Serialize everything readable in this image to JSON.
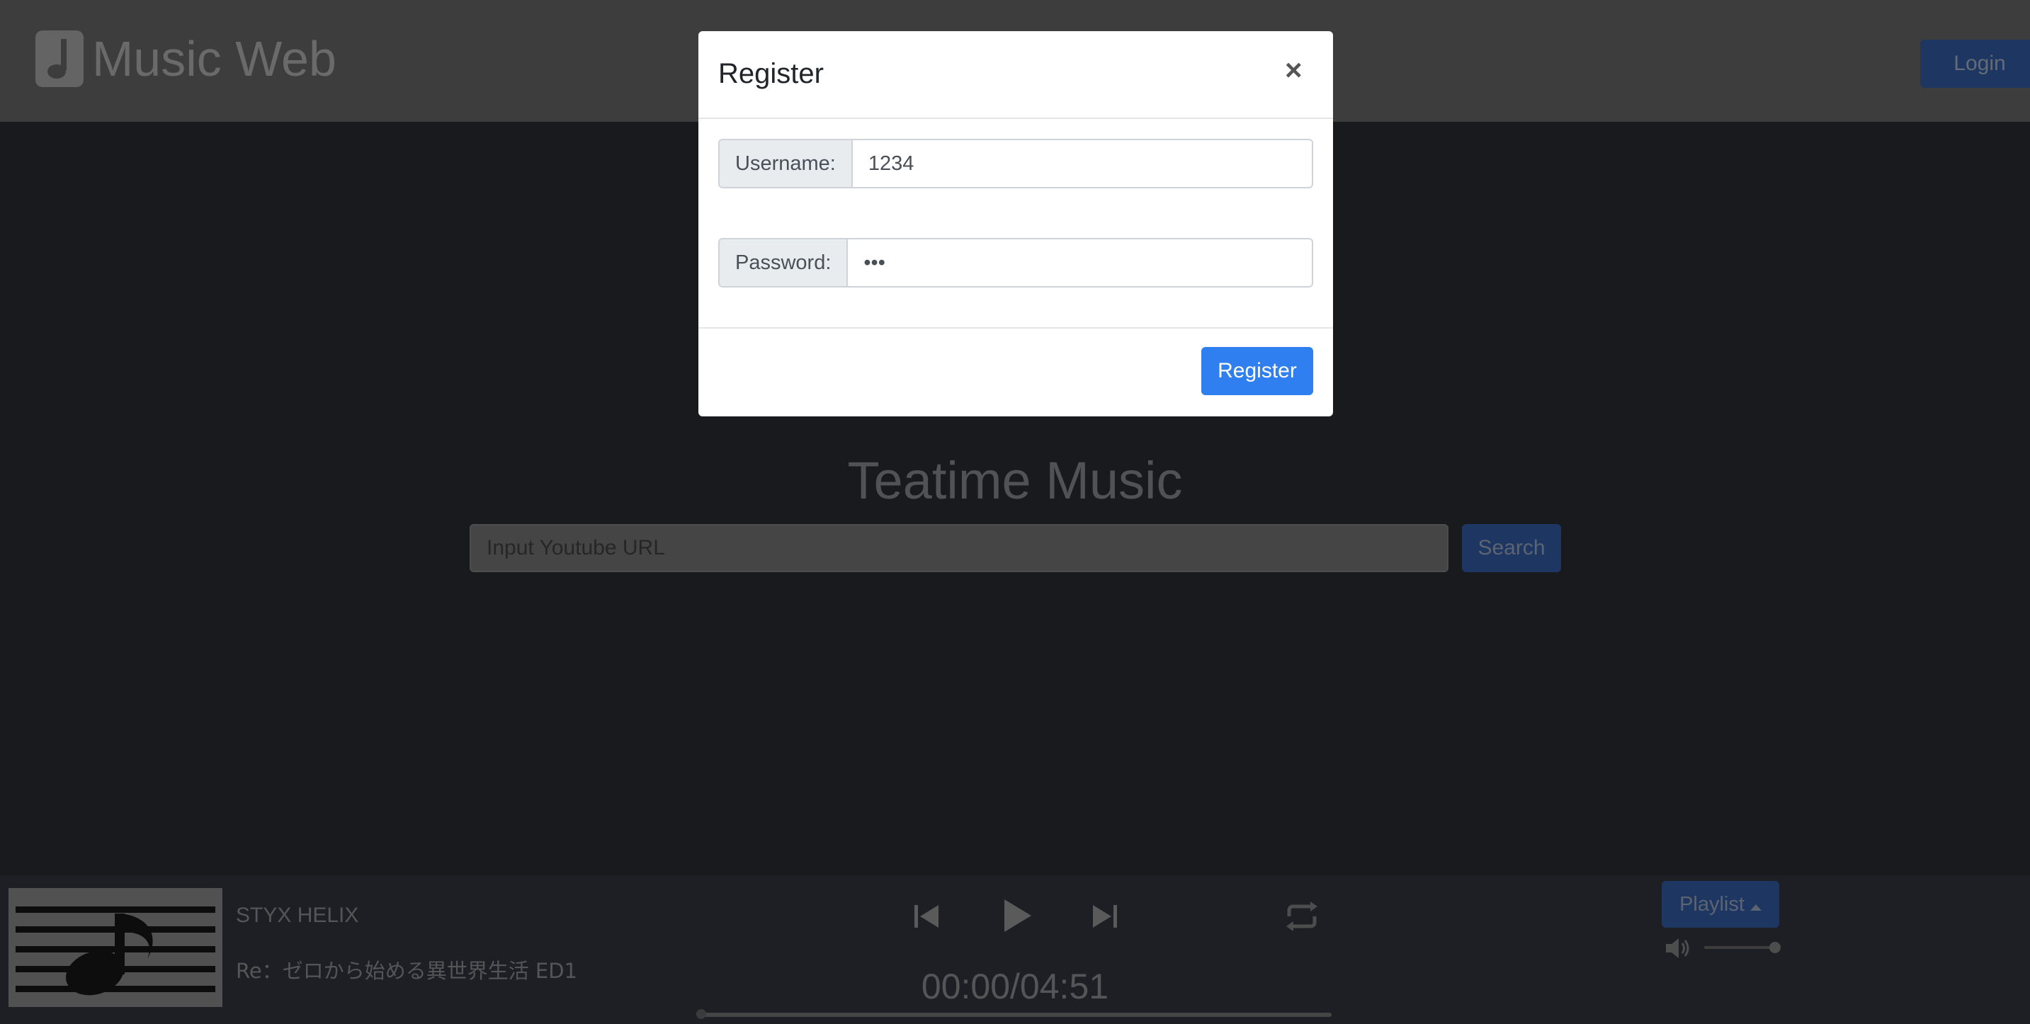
{
  "navbar": {
    "brand": "Music Web",
    "login_label": "Login"
  },
  "main": {
    "title": "Teatime Music",
    "search_placeholder": "Input Youtube URL",
    "search_label": "Search"
  },
  "player": {
    "track_title": "STYX HELIX",
    "track_subtitle": "Re：ゼロから始める異世界生活 ED1",
    "time": "00:00/04:51",
    "progress": 0.0,
    "volume": 1.0,
    "playlist_label": "Playlist"
  },
  "modal": {
    "title": "Register",
    "close_glyph": "×",
    "username_label": "Username:",
    "username_value": "1234",
    "password_label": "Password:",
    "password_value": "•••",
    "register_label": "Register"
  },
  "colors": {
    "primary": "#2f7ff0",
    "overlay": "rgba(0,0,0,0.5)"
  }
}
